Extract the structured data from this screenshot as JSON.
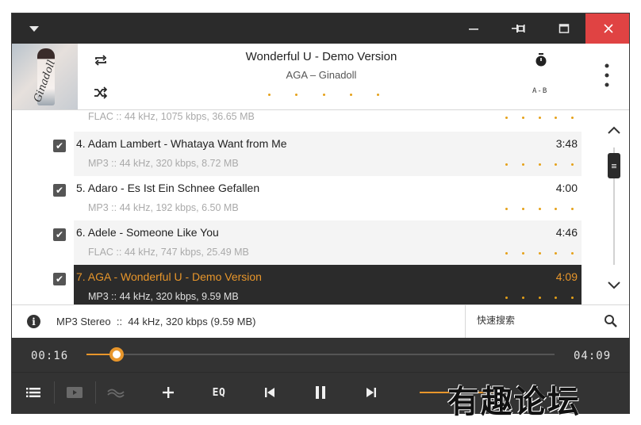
{
  "window": {
    "title_icons": [
      "menu-dropdown-icon",
      "minimize-icon",
      "pin-icon",
      "maximize-icon",
      "close-icon"
    ]
  },
  "now_playing": {
    "title": "Wonderful U - Demo Version",
    "artist": "AGA – Ginadoll",
    "ab_label": "A-B",
    "cover_signature": "Ginadoll",
    "rating_stars": 0
  },
  "playlist": {
    "rows": [
      {
        "meta": "FLAC :: 44 kHz, 1075 kbps, 36.65 MB"
      },
      {
        "title": "4. Adam Lambert - Whataya Want from Me",
        "duration": "3:48",
        "meta": "MP3 :: 44 kHz, 320 kbps, 8.72 MB",
        "checked": true
      },
      {
        "title": "5. Adaro - Es Ist Ein Schnee Gefallen",
        "duration": "4:00",
        "meta": "MP3 :: 44 kHz, 192 kbps, 6.50 MB",
        "checked": true
      },
      {
        "title": "6. Adele - Someone Like You",
        "duration": "4:46",
        "meta": "FLAC :: 44 kHz, 747 kbps, 25.49 MB",
        "checked": true
      },
      {
        "title": "7. AGA - Wonderful U - Demo Version",
        "duration": "4:09",
        "meta": "MP3 :: 44 kHz, 320 kbps, 9.59 MB",
        "checked": true,
        "active": true
      }
    ],
    "check_glyph": "✔"
  },
  "info_bar": {
    "info_glyph": "i",
    "text": "MP3 Stereo  ::  44 kHz, 320 kbps (9.59 MB)",
    "search_placeholder": "快速搜索"
  },
  "transport": {
    "elapsed": "00:16",
    "total": "04:09",
    "progress_fraction": 0.064,
    "volume_fraction": 1.0,
    "eq_label": "EQ"
  },
  "watermark": "有趣论坛",
  "colors": {
    "accent": "#e8962b",
    "titlebar": "#2b2b2b",
    "close": "#e04343",
    "active_row": "#2b2b2b",
    "transport_bg": "#333333"
  }
}
